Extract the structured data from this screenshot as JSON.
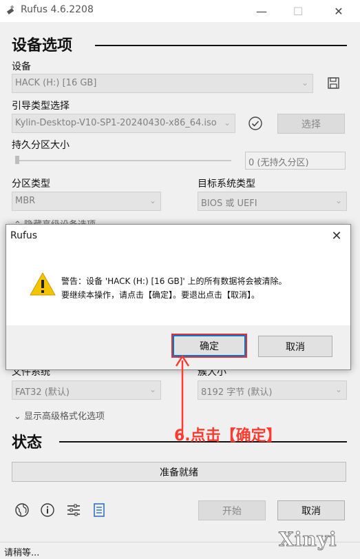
{
  "window": {
    "title": "Rufus 4.6.2208"
  },
  "device_options": {
    "header": "设备选项",
    "device_label": "设备",
    "device_value": "HACK (H:) [16 GB]",
    "boot_label": "引导类型选择",
    "boot_value": "Kylin-Desktop-V10-SP1-20240430-x86_64.iso",
    "select_button": "选择",
    "persistent_label": "持久分区大小",
    "persistent_value": "0 (无持久分区)",
    "partition_label": "分区类型",
    "partition_value": "MBR",
    "target_label": "目标系统类型",
    "target_value": "BIOS 或 UEFI",
    "advanced_toggle": "隐藏高级设备选项"
  },
  "format_options": {
    "fs_label": "文件系统",
    "fs_value": "FAT32 (默认)",
    "cluster_label": "簇大小",
    "cluster_value": "8192 字节 (默认)",
    "advanced_toggle": "显示高级格式化选项"
  },
  "status": {
    "header": "状态",
    "progress_text": "准备就绪",
    "start_button": "开始",
    "cancel_button": "取消",
    "statusbar_text": "请稍等..."
  },
  "dialog": {
    "title": "Rufus",
    "line1": "警告：设备 'HACK (H:) [16 GB]' 上的所有数据将会被清除。",
    "line2": "要继续本操作，请点击【确定】。要退出点击【取消】。",
    "ok_button": "确定",
    "cancel_button": "取消"
  },
  "annotation": "6.点击【确定】",
  "watermark": "Xinyi",
  "colors": {
    "accent": "#0078d7",
    "annotation": "#ff3b30",
    "warning": "#f5c400"
  }
}
